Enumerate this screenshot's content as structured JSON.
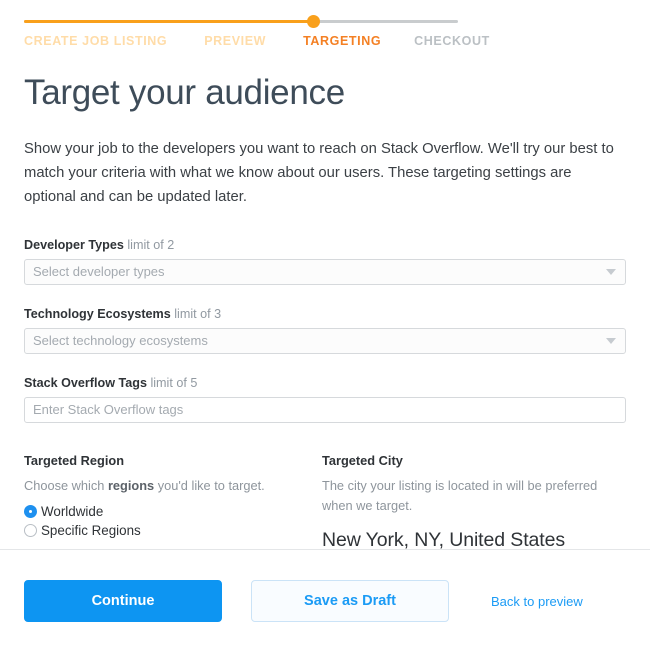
{
  "stepper": {
    "steps": [
      {
        "label": "CREATE JOB LISTING",
        "state": "done"
      },
      {
        "label": "PREVIEW",
        "state": "done"
      },
      {
        "label": "TARGETING",
        "state": "current"
      },
      {
        "label": "CHECKOUT",
        "state": "upcoming"
      }
    ],
    "progress_percent": 67,
    "accent_color": "#f9a01b",
    "current_color": "#f48024",
    "done_color": "#ffdca8",
    "upcoming_color": "#bbc0c4"
  },
  "page": {
    "headline": "Target your audience",
    "intro": "Show your job to the developers you want to reach on Stack Overflow. We'll try our best to match your criteria with what we know about our users. These targeting settings are optional and can be updated later."
  },
  "fields": [
    {
      "label_main": "Developer Types",
      "label_limit": "limit of 2",
      "placeholder": "Select developer types",
      "value": "",
      "has_caret": true,
      "name": "developer-types"
    },
    {
      "label_main": "Technology Ecosystems",
      "label_limit": "limit of 3",
      "placeholder": "Select technology ecosystems",
      "value": "",
      "has_caret": true,
      "name": "technology-ecosystems"
    },
    {
      "label_main": "Stack Overflow Tags",
      "label_limit": "limit of 5",
      "placeholder": "Enter Stack Overflow tags",
      "value": "",
      "has_caret": false,
      "name": "stack-overflow-tags"
    }
  ],
  "region": {
    "title": "Targeted Region",
    "desc_before": "Choose which ",
    "desc_emphasis": "regions",
    "desc_after": " you'd like to target.",
    "options": [
      {
        "label": "Worldwide",
        "selected": true
      },
      {
        "label": "Specific Regions",
        "selected": false
      }
    ],
    "selected_color": "#1e90ef"
  },
  "city": {
    "title": "Targeted City",
    "desc": "The city your listing is located in will be preferred when we target.",
    "value": "New York, NY, United States"
  },
  "footer": {
    "continue_label": "Continue",
    "save_draft_label": "Save as Draft",
    "back_link_label": "Back to preview",
    "primary_color": "#0d95f2",
    "secondary_text_color": "#1b9bf5"
  }
}
